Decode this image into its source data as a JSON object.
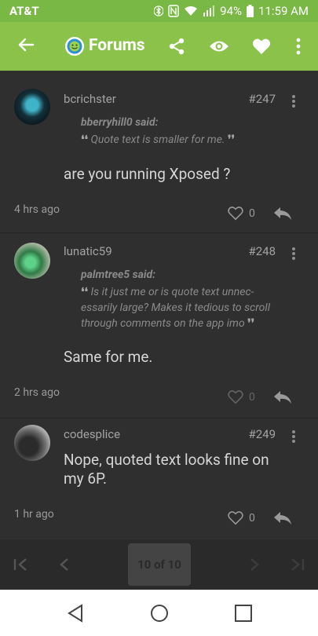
{
  "status_bar": {
    "carrier": "AT&T",
    "battery": "94%",
    "time": "11:59 AM"
  },
  "app_bar": {
    "title": "Forums"
  },
  "posts": [
    {
      "username": "bcrichster",
      "number": "#247",
      "quote_author": "bberryhill0 said:",
      "quote_text": "Quote text is smaller for me.",
      "body": "are you running Xposed ?",
      "time": "4 hrs ago",
      "likes": "0"
    },
    {
      "username": "lunatic59",
      "number": "#248",
      "quote_author": "palmtree5 said:",
      "quote_lines": [
        "Is it just me or is quote text unnec-",
        "essarily large? Makes it tedious to scroll",
        "through comments on the app imo"
      ],
      "body": "Same for me.",
      "time": "2 hrs ago",
      "likes": "0"
    },
    {
      "username": "codesplice",
      "number": "#249",
      "body_lines": [
        "Nope, quoted text looks fine on",
        "my 6P."
      ],
      "time": "1 hr ago",
      "likes": "0"
    }
  ],
  "pager": {
    "label": "10 of 10"
  },
  "colors": {
    "accent": "#8bc34a",
    "status_bar": "#7ab846",
    "background": "#303030"
  }
}
